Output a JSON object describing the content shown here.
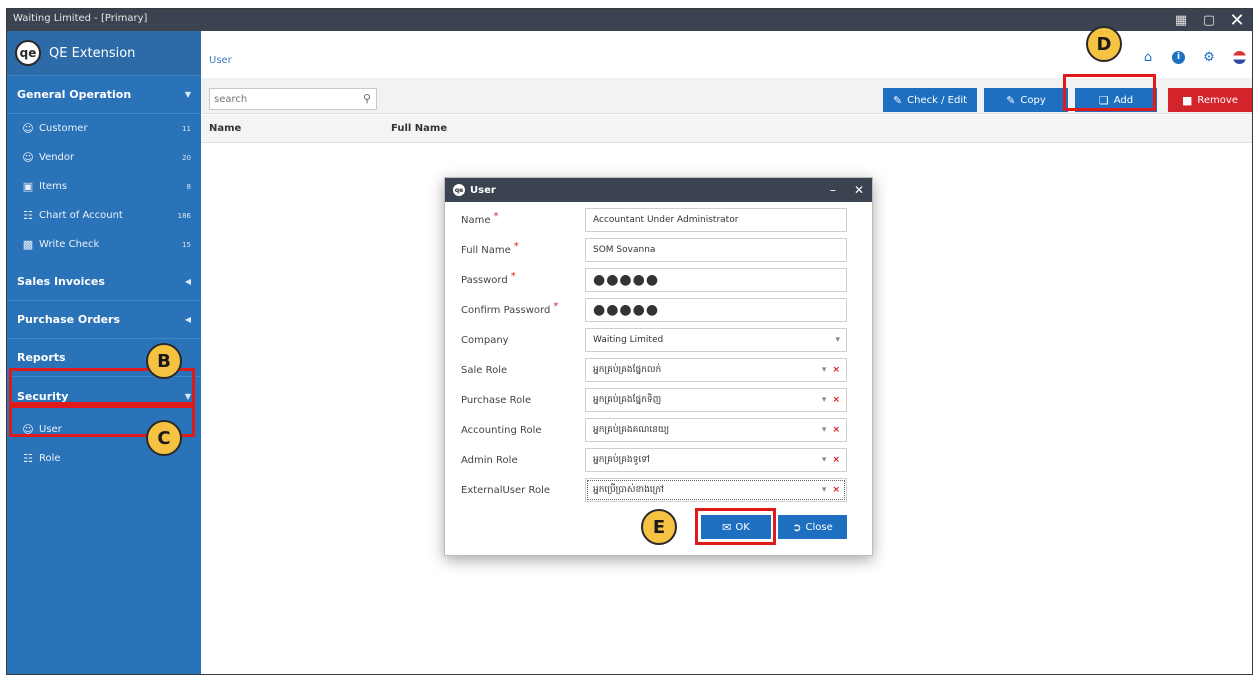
{
  "window": {
    "title": "Waiting Limited - [Primary]",
    "controls": [
      "restore-down-icon",
      "maximize-icon",
      "close-icon"
    ]
  },
  "sidebar": {
    "brand_logo": "qe",
    "brand_name": "QE Extension",
    "sections": [
      {
        "label": "General Operation",
        "caret": "down"
      },
      {
        "label": "Sales Invoices",
        "caret": "left"
      },
      {
        "label": "Purchase Orders",
        "caret": "left"
      },
      {
        "label": "Reports",
        "caret": ""
      },
      {
        "label": "Security",
        "caret": "down"
      }
    ],
    "general_items": [
      {
        "label": "Customer",
        "count": "11",
        "icon": "user-icon"
      },
      {
        "label": "Vendor",
        "count": "20",
        "icon": "user-icon"
      },
      {
        "label": "Items",
        "count": "8",
        "icon": "box-icon"
      },
      {
        "label": "Chart of Account",
        "count": "186",
        "icon": "hierarchy-icon"
      },
      {
        "label": "Write Check",
        "count": "15",
        "icon": "check-icon"
      }
    ],
    "security_items": [
      {
        "label": "User",
        "icon": "user-icon"
      },
      {
        "label": "Role",
        "icon": "hierarchy-icon"
      }
    ]
  },
  "header": {
    "breadcrumb": "User",
    "icons": [
      "home-icon",
      "info-icon",
      "settings-icon",
      "flag-icon"
    ]
  },
  "toolbar": {
    "search_placeholder": "search",
    "check_edit": "Check / Edit",
    "copy": "Copy",
    "add": "Add",
    "remove": "Remove"
  },
  "grid": {
    "columns": [
      "Name",
      "Full Name"
    ]
  },
  "dialog": {
    "title": "User",
    "fields": [
      {
        "label": "Name",
        "required": true,
        "value": "Accountant Under Administrator"
      },
      {
        "label": "Full Name",
        "required": true,
        "value": "SOM Sovanna"
      },
      {
        "label": "Password",
        "required": true,
        "value": "●●●●●"
      },
      {
        "label": "Confirm Password",
        "required": true,
        "value": "●●●●●"
      },
      {
        "label": "Company",
        "required": false,
        "value": "Waiting Limited"
      },
      {
        "label": "Sale Role",
        "required": false,
        "value": "អ្នកគ្រប់គ្រងផ្នែកលក់"
      },
      {
        "label": "Purchase Role",
        "required": false,
        "value": "អ្នកគ្រប់គ្រងផ្នែកទិញ"
      },
      {
        "label": "Accounting Role",
        "required": false,
        "value": "អ្នកគ្រប់គ្រងគណនេយ្យ"
      },
      {
        "label": "Admin Role",
        "required": false,
        "value": "អ្នកគ្រប់គ្រងទូទៅ"
      },
      {
        "label": "ExternalUser Role",
        "required": false,
        "value": "អ្នកប្រើប្រាស់ខាងក្រៅ"
      }
    ],
    "ok": "OK",
    "close": "Close"
  },
  "callouts": {
    "b": "B",
    "c": "C",
    "d": "D",
    "e": "E"
  },
  "colors": {
    "sidebar": "#2a73b8",
    "primary_button": "#1e6fc0",
    "danger_button": "#d2242a",
    "highlight": "#e0191b",
    "callout": "#f5c242"
  }
}
